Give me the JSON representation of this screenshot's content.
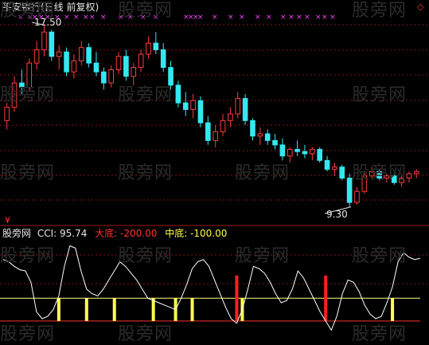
{
  "title": "平安银行(日线 前复权)",
  "price_high_label": "17.50",
  "price_low_label": "9.30",
  "watermark": "股旁网",
  "indicator": {
    "name": "股旁网",
    "cci_text": "CCI: 95.74",
    "dadi_text": "大底: -200.00",
    "zhongdi_text": "中底: -100.00"
  },
  "icons": {
    "corner": "diamond-icon",
    "bottom": "rmb-icon",
    "signal": "x-marker-icon"
  },
  "colors": {
    "background": "#000000",
    "up_candle": "#ff3c3c",
    "down_candle": "#35e8f0",
    "grid": "#8a1010",
    "signal_marker": "#ff40ff",
    "cci_line": "#ffffff",
    "mid_line": "#ffff80",
    "low_line": "#ff3030",
    "mid_bar": "#ffff50",
    "low_bar": "#ff2020"
  },
  "chart_data": [
    {
      "type": "candlestick",
      "title": "平安银行(日线 前复权)",
      "series": [
        {
          "values": [
            [
              13.2,
              14.0,
              12.8,
              13.8
            ],
            [
              13.8,
              15.2,
              13.6,
              14.9
            ],
            [
              14.9,
              15.5,
              14.4,
              14.7
            ],
            [
              14.7,
              16.0,
              14.5,
              15.8
            ],
            [
              15.8,
              16.8,
              15.5,
              16.4
            ],
            [
              16.4,
              17.5,
              16.1,
              17.2
            ],
            [
              17.2,
              17.3,
              15.9,
              16.1
            ],
            [
              16.1,
              16.6,
              15.5,
              16.3
            ],
            [
              16.3,
              16.5,
              15.2,
              15.4
            ],
            [
              15.4,
              16.2,
              15.1,
              15.9
            ],
            [
              15.9,
              16.8,
              15.7,
              16.5
            ],
            [
              16.5,
              16.7,
              15.6,
              15.8
            ],
            [
              15.8,
              16.3,
              15.2,
              15.4
            ],
            [
              15.4,
              15.6,
              14.6,
              14.9
            ],
            [
              14.9,
              15.7,
              14.7,
              15.5
            ],
            [
              15.5,
              16.3,
              15.3,
              16.1
            ],
            [
              16.1,
              16.4,
              15.0,
              15.2
            ],
            [
              15.2,
              15.8,
              14.8,
              15.6
            ],
            [
              15.6,
              16.4,
              15.4,
              16.2
            ],
            [
              16.2,
              17.0,
              16.0,
              16.7
            ],
            [
              16.7,
              17.2,
              16.2,
              16.4
            ],
            [
              16.4,
              16.7,
              15.4,
              15.6
            ],
            [
              15.6,
              15.9,
              14.6,
              14.8
            ],
            [
              14.8,
              15.0,
              13.8,
              14.0
            ],
            [
              14.0,
              14.5,
              13.4,
              13.7
            ],
            [
              13.7,
              14.4,
              13.3,
              14.1
            ],
            [
              14.1,
              14.3,
              12.9,
              13.1
            ],
            [
              13.1,
              13.4,
              12.1,
              12.3
            ],
            [
              12.3,
              13.0,
              12.0,
              12.7
            ],
            [
              12.7,
              13.5,
              12.5,
              13.2
            ],
            [
              13.2,
              13.8,
              12.9,
              13.5
            ],
            [
              13.5,
              14.5,
              13.3,
              14.2
            ],
            [
              14.2,
              14.4,
              13.0,
              13.2
            ],
            [
              13.2,
              13.3,
              12.3,
              12.5
            ],
            [
              12.5,
              12.9,
              12.1,
              12.6
            ],
            [
              12.6,
              12.8,
              12.1,
              12.3
            ],
            [
              12.3,
              12.6,
              11.9,
              12.1
            ],
            [
              12.1,
              12.4,
              11.4,
              11.6
            ],
            [
              11.6,
              12.0,
              11.3,
              11.9
            ],
            [
              11.9,
              12.3,
              11.6,
              11.8
            ],
            [
              11.8,
              12.1,
              11.5,
              11.7
            ],
            [
              11.7,
              12.0,
              11.4,
              11.9
            ],
            [
              11.9,
              12.0,
              11.3,
              11.4
            ],
            [
              11.4,
              11.6,
              10.9,
              11.0
            ],
            [
              11.0,
              11.3,
              10.7,
              11.1
            ],
            [
              11.1,
              11.2,
              10.5,
              10.6
            ],
            [
              10.6,
              10.8,
              9.3,
              9.5
            ],
            [
              9.5,
              10.2,
              9.4,
              10.0
            ],
            [
              10.0,
              10.9,
              9.9,
              10.7
            ],
            [
              10.7,
              11.1,
              10.6,
              10.9
            ],
            [
              10.9,
              11.0,
              10.5,
              10.6
            ],
            [
              10.6,
              10.8,
              10.4,
              10.7
            ],
            [
              10.7,
              10.8,
              10.3,
              10.4
            ],
            [
              10.4,
              10.7,
              10.2,
              10.6
            ],
            [
              10.6,
              10.9,
              10.4,
              10.8
            ],
            [
              10.8,
              11.0,
              10.6,
              10.9
            ]
          ]
        }
      ],
      "ylim": [
        9.0,
        18.0
      ],
      "annotations": [
        "17.50",
        "9.30"
      ]
    },
    {
      "type": "line",
      "series": [
        {
          "name": "CCI",
          "values": [
            70,
            60,
            40,
            25,
            20,
            -30,
            -160,
            -190,
            -180,
            -150,
            -90,
            40,
            130,
            120,
            20,
            -60,
            -80,
            -90,
            -60,
            -20,
            20,
            60,
            40,
            10,
            -20,
            -60,
            -100,
            -110,
            -120,
            -130,
            -140,
            -150,
            -100,
            -40,
            30,
            60,
            70,
            40,
            -20,
            -80,
            -140,
            -190,
            -210,
            -150,
            -60,
            40,
            30,
            10,
            -30,
            -80,
            -120,
            -110,
            -60,
            20,
            -10,
            -60,
            -110,
            -160,
            -200,
            -240,
            -180,
            -80,
            -20,
            -30,
            -70,
            -130,
            -170,
            -190,
            -180,
            -120,
            -50,
            60,
            100,
            80,
            70,
            75
          ]
        }
      ],
      "reference_lines": [
        -100,
        -200
      ],
      "zhongdi_bar_positions": [
        10,
        15,
        20,
        27,
        31,
        34,
        43,
        70
      ],
      "dadi_bar_positions": [
        42,
        58
      ],
      "ylim": [
        -260,
        160
      ]
    }
  ]
}
